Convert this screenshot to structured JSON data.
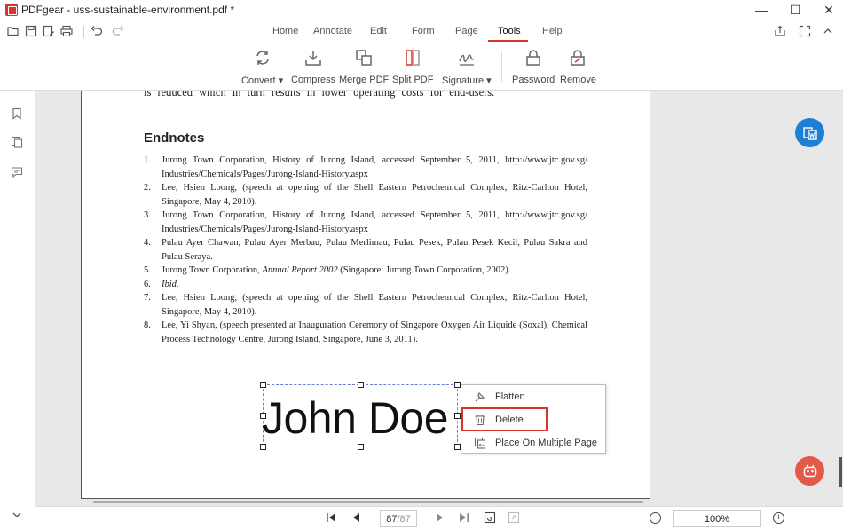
{
  "window": {
    "title": "PDFgear - uss-sustainable-environment.pdf *",
    "controls": {
      "minimize": "—",
      "maximize": "☐",
      "close": "✕"
    }
  },
  "menu": {
    "tabs": [
      {
        "label": "Home"
      },
      {
        "label": "Annotate"
      },
      {
        "label": "Edit"
      },
      {
        "label": "Form"
      },
      {
        "label": "Page"
      },
      {
        "label": "Tools",
        "active": true
      },
      {
        "label": "Help"
      }
    ]
  },
  "ribbon": {
    "convert": "Convert ▾",
    "compress": "Compress",
    "merge": "Merge PDF",
    "split": "Split PDF",
    "signature": "Signature ▾",
    "password": "Password",
    "remove": "Remove"
  },
  "document": {
    "cut_line": "is reduced which in turn results in lower operating costs for end-users.",
    "endnotes_title": "Endnotes",
    "notes": [
      {
        "num": "1.",
        "text": "Jurong Town Corporation, History of Jurong Island, accessed September 5, 2011, http://www.jtc.gov.sg/ Industries/Chemicals/Pages/Jurong-Island-History.aspx"
      },
      {
        "num": "2.",
        "text": "Lee, Hsien Loong, (speech at opening of the Shell Eastern Petrochemical Complex, Ritz-Carlton Hotel, Singapore, May 4, 2010)."
      },
      {
        "num": "3.",
        "text": "Jurong Town Corporation, History of Jurong Island, accessed September 5, 2011, http://www.jtc.gov.sg/ Industries/Chemicals/Pages/Jurong-Island-History.aspx"
      },
      {
        "num": "4.",
        "text": "Pulau Ayer Chawan, Pulau Ayer Merbau, Pulau Merlimau, Pulau Pesek, Pulau Pesek Kecil, Pulau Sakra and Pulau Seraya."
      },
      {
        "num": "5.",
        "text_before": "Jurong Town Corporation, ",
        "text_italic": "Annual Report 2002",
        "text_after": " (Singapore: Jurong Town Corporation, 2002)."
      },
      {
        "num": "6.",
        "text_italic": "Ibid."
      },
      {
        "num": "7.",
        "text": "Lee, Hsien Loong, (speech at opening of the Shell Eastern Petrochemical Complex, Ritz-Carlton Hotel, Singapore, May 4, 2010)."
      },
      {
        "num": "8.",
        "text": "Lee, Yi Shyan, (speech presented at Inauguration Ceremony of Singapore Oxygen Air Liquide (Soxal), Chemical Process Technology Centre, Jurong Island, Singapore, June 3, 2011)."
      }
    ],
    "signature": "John Doe"
  },
  "context_menu": {
    "flatten": "Flatten",
    "delete": "Delete",
    "place_multiple": "Place On Multiple Page"
  },
  "navigation": {
    "current_page": "87",
    "total_pages": "/87",
    "zoom": "100%",
    "zoom_out": "−",
    "zoom_in": "+"
  },
  "colors": {
    "accent": "#d9342b",
    "float_blue": "#1e7fd6",
    "float_red": "#e45a4a"
  }
}
